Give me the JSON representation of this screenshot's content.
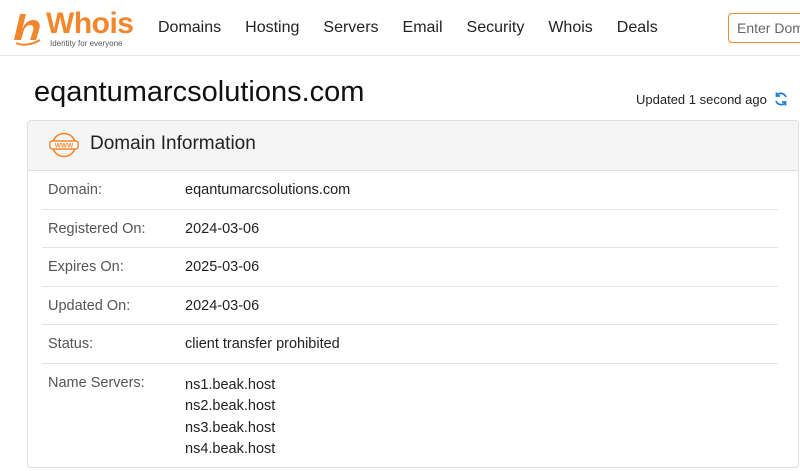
{
  "brand": {
    "name": "Whois",
    "tagline": "Identity for everyone",
    "color": "#f1862d"
  },
  "nav": {
    "items": [
      {
        "label": "Domains"
      },
      {
        "label": "Hosting"
      },
      {
        "label": "Servers"
      },
      {
        "label": "Email"
      },
      {
        "label": "Security"
      },
      {
        "label": "Whois"
      },
      {
        "label": "Deals"
      }
    ]
  },
  "search": {
    "placeholder": "Enter Domain",
    "value": ""
  },
  "page": {
    "title": "eqantumarcsolutions.com",
    "updated_text": "Updated 1 second ago",
    "refresh_icon": "refresh-icon"
  },
  "panel": {
    "title": "Domain Information",
    "icon": "www-icon",
    "rows": [
      {
        "label": "Domain:",
        "value": "eqantumarcsolutions.com"
      },
      {
        "label": "Registered On:",
        "value": "2024-03-06"
      },
      {
        "label": "Expires On:",
        "value": "2025-03-06"
      },
      {
        "label": "Updated On:",
        "value": "2024-03-06"
      },
      {
        "label": "Status:",
        "value": "client transfer prohibited"
      }
    ],
    "name_servers": {
      "label": "Name Servers:",
      "values": [
        "ns1.beak.host",
        "ns2.beak.host",
        "ns3.beak.host",
        "ns4.beak.host"
      ]
    }
  }
}
